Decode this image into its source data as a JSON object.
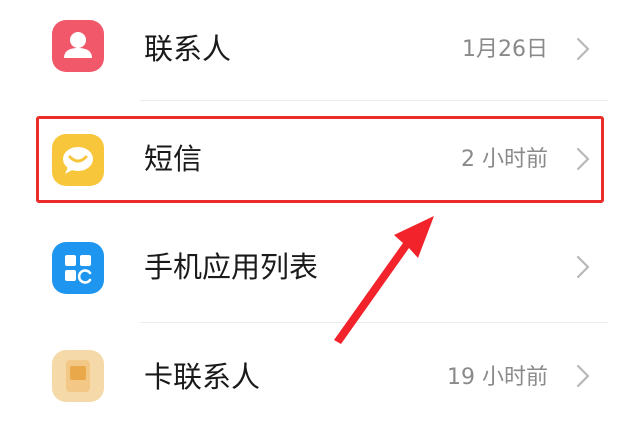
{
  "items": [
    {
      "label": "联系人",
      "meta": "1月26日",
      "icon": "contacts-icon"
    },
    {
      "label": "短信",
      "meta": "2 小时前",
      "icon": "messages-icon"
    },
    {
      "label": "手机应用列表",
      "meta": "",
      "icon": "app-list-icon"
    },
    {
      "label": "卡联系人",
      "meta": "19 小时前",
      "icon": "sim-card-icon"
    }
  ],
  "colors": {
    "contacts_icon_bg": "#f1586a",
    "messages_icon_bg": "#f7c63a",
    "app_list_icon_bg": "#1e96f0",
    "sim_icon_bg": "#f6d9a8",
    "highlight": "#ec2b2b",
    "annotation_arrow": "#f2232b"
  }
}
